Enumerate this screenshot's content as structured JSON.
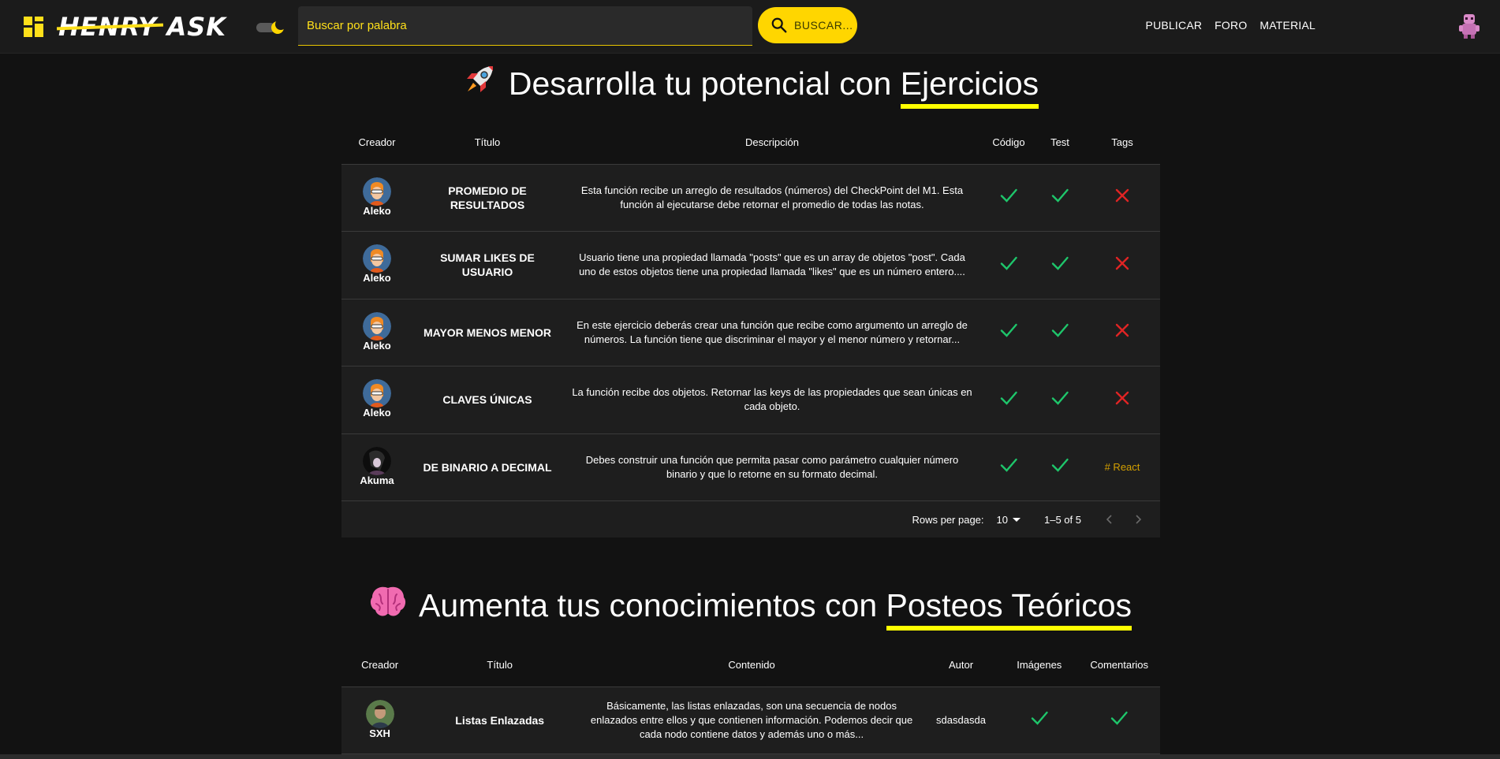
{
  "navbar": {
    "logo_text": "HENRY ASK",
    "search_placeholder": "Buscar por palabra",
    "search_button": "BUSCAR...",
    "links": [
      "PUBLICAR",
      "FORO",
      "MATERIAL"
    ]
  },
  "colors": {
    "accent": "#ffd600",
    "highlight": "#ffff00",
    "check": "#1ec66b",
    "cross": "#e02424",
    "tag": "#d4a000"
  },
  "exercises": {
    "title_prefix": "Desarrolla tu potencial con ",
    "title_highlight": "Ejercicios",
    "emoji_icon": "rocket-icon",
    "columns": [
      "Creador",
      "Título",
      "Descripción",
      "Código",
      "Test",
      "Tags"
    ],
    "rows": [
      {
        "creator": "Aleko",
        "title": "PROMEDIO DE RESULTADOS",
        "description": "Esta función recibe un arreglo de resultados (números) del CheckPoint del M1. Esta función al ejecutarse debe retornar el promedio de todas las notas.",
        "code": true,
        "test": true,
        "tags": null
      },
      {
        "creator": "Aleko",
        "title": "SUMAR LIKES DE USUARIO",
        "description": "Usuario tiene una propiedad llamada \"posts\" que es un array de objetos \"post\". Cada uno de estos objetos tiene una propiedad llamada \"likes\" que es un número entero....",
        "code": true,
        "test": true,
        "tags": null
      },
      {
        "creator": "Aleko",
        "title": "MAYOR MENOS MENOR",
        "description": "En este ejercicio deberás crear una función que recibe como argumento un arreglo de números. La función tiene que discriminar el mayor y el menor número y retornar...",
        "code": true,
        "test": true,
        "tags": null
      },
      {
        "creator": "Aleko",
        "title": "CLAVES ÚNICAS",
        "description": "La función recibe dos objetos. Retornar las keys de las propiedades que sean únicas en cada objeto.",
        "code": true,
        "test": true,
        "tags": null
      },
      {
        "creator": "Akuma",
        "title": "DE BINARIO A DECIMAL",
        "description": "Debes construir una función que permita pasar como parámetro cualquier número binario y que lo retorne en su formato decimal.",
        "code": true,
        "test": true,
        "tags": "# React"
      }
    ],
    "pagination": {
      "rows_per_page_label": "Rows per page:",
      "rows_per_page": "10",
      "range": "1–5 of 5"
    }
  },
  "posts": {
    "title_prefix": "Aumenta tus conocimientos con ",
    "title_highlight": "Posteos Teóricos",
    "emoji_icon": "brain-icon",
    "columns": [
      "Creador",
      "Título",
      "Contenido",
      "Autor",
      "Imágenes",
      "Comentarios"
    ],
    "rows": [
      {
        "creator": "SXH",
        "title": "Listas Enlazadas",
        "content": "Básicamente, las listas enlazadas, son una secuencia de nodos enlazados entre ellos y que contienen información. Podemos decir que cada nodo contiene datos y además uno o más...",
        "author": "sdasdasda",
        "images": true,
        "comments": true
      }
    ]
  }
}
